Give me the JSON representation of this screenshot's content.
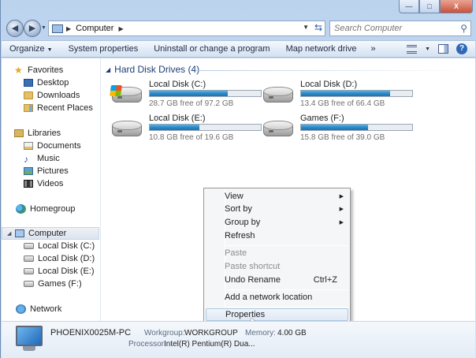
{
  "window": {
    "minimize_label": "—",
    "maximize_label": "□",
    "close_label": "X"
  },
  "address": {
    "crumbs": [
      "Computer"
    ],
    "search_placeholder": "Search Computer"
  },
  "toolbar": {
    "organize": "Organize",
    "system_properties": "System properties",
    "uninstall": "Uninstall or change a program",
    "map_network": "Map network drive",
    "more": "»"
  },
  "sidebar": {
    "favorites": "Favorites",
    "desktop": "Desktop",
    "downloads": "Downloads",
    "recent": "Recent Places",
    "libraries": "Libraries",
    "documents": "Documents",
    "music": "Music",
    "pictures": "Pictures",
    "videos": "Videos",
    "homegroup": "Homegroup",
    "computer": "Computer",
    "drives": [
      "Local Disk (C:)",
      "Local Disk (D:)",
      "Local Disk (E:)",
      "Games (F:)"
    ],
    "network": "Network"
  },
  "content": {
    "group_title": "Hard Disk Drives (4)",
    "drives": [
      {
        "name": "Local Disk (C:)",
        "free": "28.7 GB free of 97.2 GB",
        "used_fraction": 0.7
      },
      {
        "name": "Local Disk (D:)",
        "free": "13.4 GB free of 66.4 GB",
        "used_fraction": 0.8
      },
      {
        "name": "Local Disk (E:)",
        "free": "10.8 GB free of 19.6 GB",
        "used_fraction": 0.45
      },
      {
        "name": "Games (F:)",
        "free": "15.8 GB free of 39.0 GB",
        "used_fraction": 0.6
      }
    ]
  },
  "context_menu": {
    "view": "View",
    "sort_by": "Sort by",
    "group_by": "Group by",
    "refresh": "Refresh",
    "paste": "Paste",
    "paste_shortcut": "Paste shortcut",
    "undo_rename": "Undo Rename",
    "undo_shortcut": "Ctrl+Z",
    "add_network_location": "Add a network location",
    "properties": "Properties"
  },
  "details": {
    "computer_name": "PHOENIX0025M-PC",
    "workgroup_label": "Workgroup:",
    "workgroup_value": "WORKGROUP",
    "memory_label": "Memory:",
    "memory_value": "4.00 GB",
    "processor_label": "Processor:",
    "processor_value": "Intel(R) Pentium(R) Dua..."
  },
  "colors": {
    "accent": "#2c88c9",
    "header_text": "#1e3c78"
  }
}
